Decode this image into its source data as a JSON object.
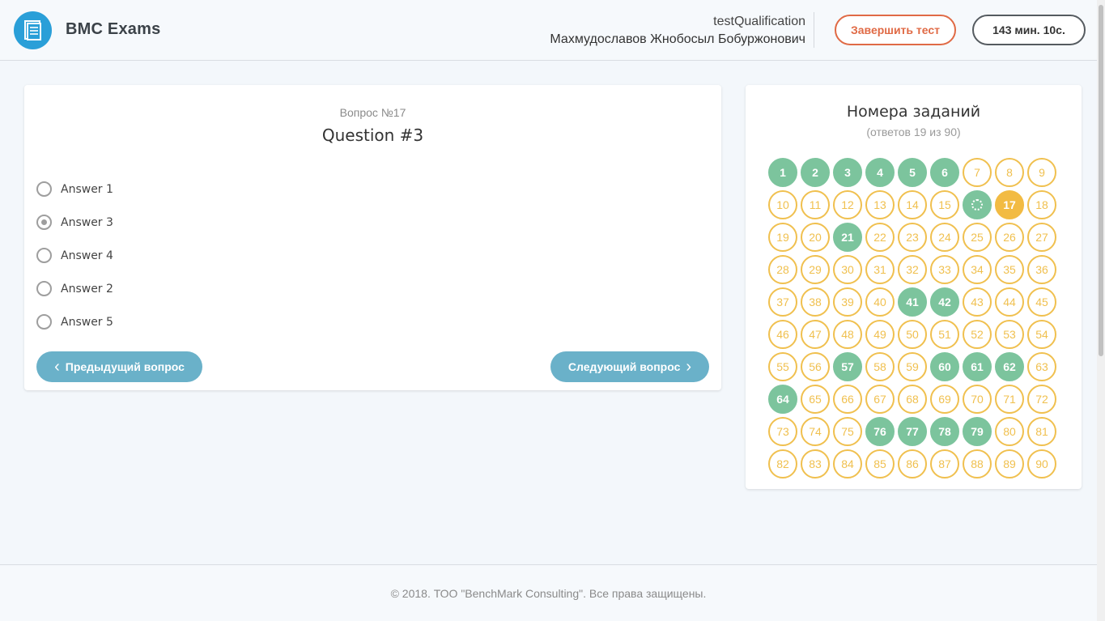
{
  "header": {
    "brand": "BMC Exams",
    "logo_icon": "exam-sheet-icon",
    "qualification": "testQualification",
    "user_name": "Махмудославов Жнобосыл Бобуржонович",
    "finish_label": "Завершить тест",
    "timer": "143 мин. 10с."
  },
  "question": {
    "number_label": "Вопрос №17",
    "title": "Question #3",
    "answers": [
      {
        "label": "Answer 1",
        "checked": false
      },
      {
        "label": "Answer 3",
        "checked": true
      },
      {
        "label": "Answer 4",
        "checked": false
      },
      {
        "label": "Answer 2",
        "checked": false
      },
      {
        "label": "Answer 5",
        "checked": false
      }
    ],
    "prev_label": "Предыдущий вопрос",
    "next_label": "Следующий вопрос"
  },
  "tasks": {
    "title": "Номера заданий",
    "subtitle": "(ответов 19 из 90)",
    "total": 90,
    "current": 17,
    "loading": [
      16
    ],
    "answered": [
      1,
      2,
      3,
      4,
      5,
      6,
      21,
      41,
      42,
      57,
      60,
      61,
      62,
      64,
      76,
      77,
      78,
      79
    ]
  },
  "colors": {
    "answered": "#7cc49d",
    "current": "#f2bb43",
    "unanswered_border": "#f0c04f",
    "finish": "#e06a45",
    "nav_button": "#6ab1c9",
    "logo": "#2a9fd8"
  },
  "footer": {
    "text": "© 2018. ТОО \"BenchMark Consulting\". Все права защищены."
  }
}
